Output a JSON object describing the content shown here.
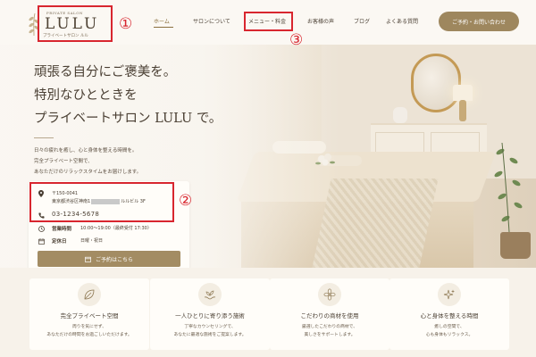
{
  "logo": {
    "small_text": "PRIVATE SALON",
    "main_text": "LULU",
    "sub_text": "プライベートサロン ルル"
  },
  "nav": {
    "items": [
      "ホーム",
      "サロンについて",
      "メニュー・料金",
      "お客様の声",
      "ブログ",
      "よくある質問"
    ],
    "cta_label": "ご予約・お問い合わせ"
  },
  "annotations": [
    "①",
    "②",
    "③"
  ],
  "hero": {
    "headline_lines": [
      "頑張る自分にご褒美を。",
      "特別なひとときを",
      "プライベートサロン LULU で。"
    ],
    "intro_lines": [
      "日々の疲れを癒し、心と身体を整える時間を。",
      "完全プライベート空間で、",
      "あなただけのリラックスタイムをお届けします。"
    ]
  },
  "info_card": {
    "postal": "〒150-0041",
    "address_pre": "東京都渋谷区神南1",
    "address_post": "ルルビル 3F",
    "phone": "03-1234-5678",
    "hours_label": "営業時間",
    "hours_value": "10:00～19:00（最終受付 17:30）",
    "closed_label": "定休日",
    "closed_value": "日曜・祝日",
    "reserve_label": "ご予約はこちら"
  },
  "features": [
    {
      "icon": "leaf-icon",
      "title": "完全プライベート空間",
      "desc1": "周りを気にせず、",
      "desc2": "あなただけの時間をお過ごしいただけます。"
    },
    {
      "icon": "hands-plant-icon",
      "title": "一人ひとりに寄り添う施術",
      "desc1": "丁寧なカウンセリングで、",
      "desc2": "あなたに最適な施術をご提案します。"
    },
    {
      "icon": "flower-icon",
      "title": "こだわりの商材を使用",
      "desc1": "厳選したこだわりの商材で、",
      "desc2": "美しさをサポートします。"
    },
    {
      "icon": "sparkle-icon",
      "title": "心と身体を整える時間",
      "desc1": "癒しの空間で、",
      "desc2": "心も身体もリラックス。"
    }
  ],
  "colors": {
    "accent": "#9e875e",
    "annotation": "#d8262f",
    "background": "#faf7f2"
  }
}
